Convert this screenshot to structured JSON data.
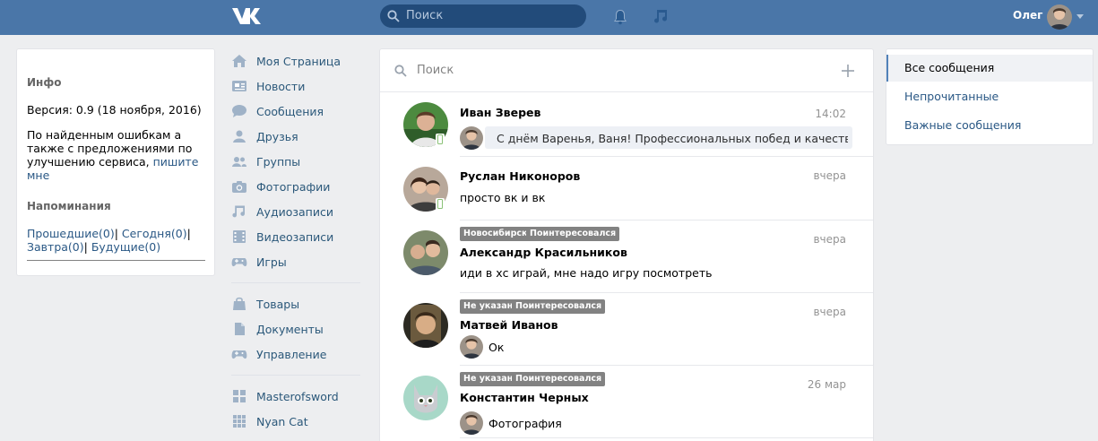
{
  "header": {
    "search_placeholder": "Поиск",
    "user_name": "Олег"
  },
  "info": {
    "title": "Инфо",
    "version": "Версия: 0.9 (18 ноября, 2016)",
    "bugs_text": "По найденным ошибкам а также с предложениями по улучшению сервиса,",
    "bugs_link": "пишите мне",
    "reminders_title": "Напоминания",
    "reminders": [
      "Прошедшие(0)",
      "Сегодня(0)",
      "Завтра(0)",
      "Будущие(0)"
    ]
  },
  "menu": {
    "items": [
      {
        "label": "Моя Страница",
        "icon": "home-icon"
      },
      {
        "label": "Новости",
        "icon": "news-icon"
      },
      {
        "label": "Сообщения",
        "icon": "messages-icon"
      },
      {
        "label": "Друзья",
        "icon": "friends-icon"
      },
      {
        "label": "Группы",
        "icon": "groups-icon"
      },
      {
        "label": "Фотографии",
        "icon": "camera-icon"
      },
      {
        "label": "Аудиозаписи",
        "icon": "music-icon"
      },
      {
        "label": "Видеозаписи",
        "icon": "film-icon"
      },
      {
        "label": "Игры",
        "icon": "gamepad-icon"
      },
      {
        "label": "Товары",
        "icon": "bag-icon"
      },
      {
        "label": "Документы",
        "icon": "document-icon"
      },
      {
        "label": "Управление",
        "icon": "gamepad-icon"
      },
      {
        "label": "Masterofsword",
        "icon": "apps-icon"
      },
      {
        "label": "Nyan Cat",
        "icon": "apps-grid-icon"
      }
    ]
  },
  "messages": {
    "search_placeholder": "Поиск",
    "dialogs": [
      {
        "name": "Иван Зверев",
        "time": "14:02",
        "text": "С днём Варенья, Ваня! Профессиональных побед и качественн...",
        "tags": []
      },
      {
        "name": "Руслан Никоноров",
        "time": "вчера",
        "text": "просто вк и вк",
        "tags": []
      },
      {
        "name": "Александр Красильников",
        "time": "вчера",
        "text": "иди в хс играй, мне надо игру посмотреть",
        "tags": [
          "Новосибирск",
          "Поинтересовался"
        ]
      },
      {
        "name": "Матвей Иванов",
        "time": "вчера",
        "text": "Ок",
        "tags": [
          "Не указан",
          "Поинтересовался"
        ]
      },
      {
        "name": "Константин Черных",
        "time": "26 мар",
        "text": "Фотография",
        "tags": [
          "Не указан",
          "Поинтересовался"
        ]
      }
    ]
  },
  "filters": {
    "items": [
      "Все сообщения",
      "Непрочитанные",
      "Важные сообщения"
    ],
    "active": "Все сообщения"
  },
  "colors": {
    "header": "#4a76a8",
    "link": "#2a5885",
    "background": "#edeef0"
  }
}
